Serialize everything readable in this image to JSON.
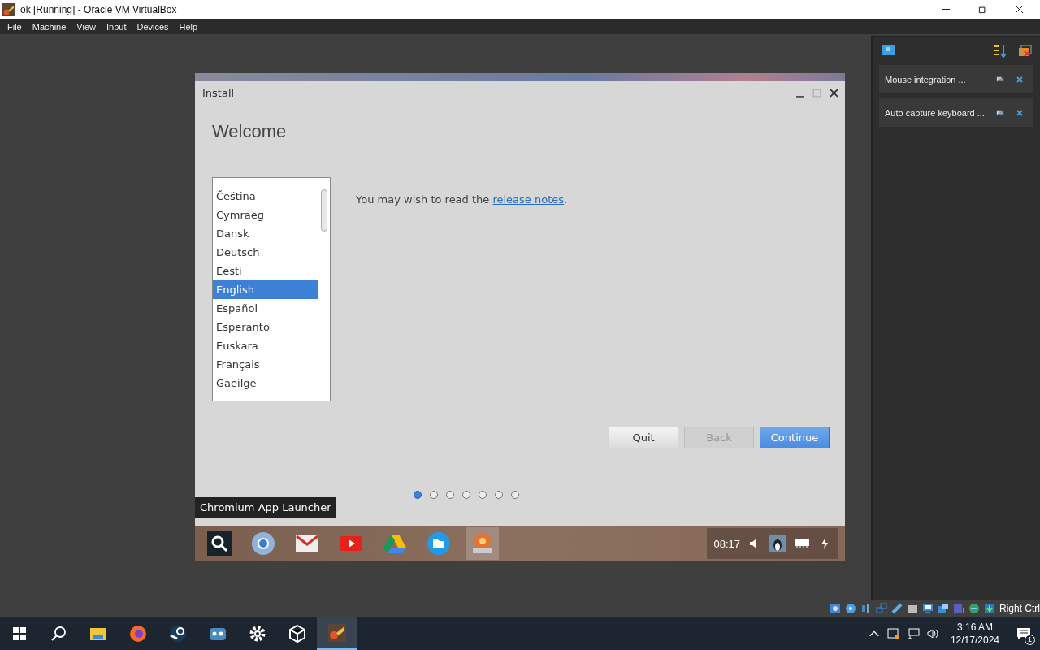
{
  "window": {
    "title": "ok [Running] - Oracle VM VirtualBox"
  },
  "menu": [
    "File",
    "Machine",
    "View",
    "Input",
    "Devices",
    "Help"
  ],
  "installer": {
    "title": "Install",
    "heading": "Welcome",
    "languages": [
      {
        "label": "Čeština",
        "selected": false
      },
      {
        "label": "Cymraeg",
        "selected": false
      },
      {
        "label": "Dansk",
        "selected": false
      },
      {
        "label": "Deutsch",
        "selected": false
      },
      {
        "label": "Eesti",
        "selected": false
      },
      {
        "label": "English",
        "selected": true
      },
      {
        "label": "Español",
        "selected": false
      },
      {
        "label": "Esperanto",
        "selected": false
      },
      {
        "label": "Euskara",
        "selected": false
      },
      {
        "label": "Français",
        "selected": false
      },
      {
        "label": "Gaeilge",
        "selected": false
      }
    ],
    "notes": {
      "text": "You may wish to read the",
      "link": "release notes",
      "end": "."
    },
    "buttons": [
      {
        "label": "Quit",
        "kind": "secondary",
        "disabled": false
      },
      {
        "label": "Back",
        "kind": "secondary",
        "disabled": true
      },
      {
        "label": "Continue",
        "kind": "primary",
        "disabled": false
      }
    ],
    "steps": [
      {
        "selected": true
      },
      {
        "selected": false
      },
      {
        "selected": false
      },
      {
        "selected": false
      },
      {
        "selected": false
      },
      {
        "selected": false
      },
      {
        "selected": false
      }
    ]
  },
  "tooltip": "Chromium App Launcher",
  "shelf": {
    "apps": [
      {
        "kind": "launcher",
        "selected": false
      },
      {
        "kind": "chromium",
        "selected": false
      },
      {
        "kind": "mail",
        "selected": false
      },
      {
        "kind": "video",
        "selected": false
      },
      {
        "kind": "drive",
        "selected": false
      },
      {
        "kind": "files",
        "selected": false
      },
      {
        "kind": "installer",
        "selected": true
      }
    ],
    "clock": "08:17"
  },
  "notifications": [
    {
      "text": "Mouse integration ..."
    },
    {
      "text": "Auto capture keyboard ..."
    }
  ],
  "status_bar": {
    "host_key": "Right Ctrl"
  },
  "taskbar": {
    "apps": [
      {
        "kind": "explorer",
        "selected": false
      },
      {
        "kind": "firefox",
        "selected": false
      },
      {
        "kind": "steam",
        "selected": false
      },
      {
        "kind": "editor",
        "selected": false
      },
      {
        "kind": "settings",
        "selected": false
      },
      {
        "kind": "cube",
        "selected": false
      },
      {
        "kind": "vm",
        "selected": true
      }
    ],
    "time": "3:16 AM",
    "date": "12/17/2024",
    "notification_count": "1"
  }
}
